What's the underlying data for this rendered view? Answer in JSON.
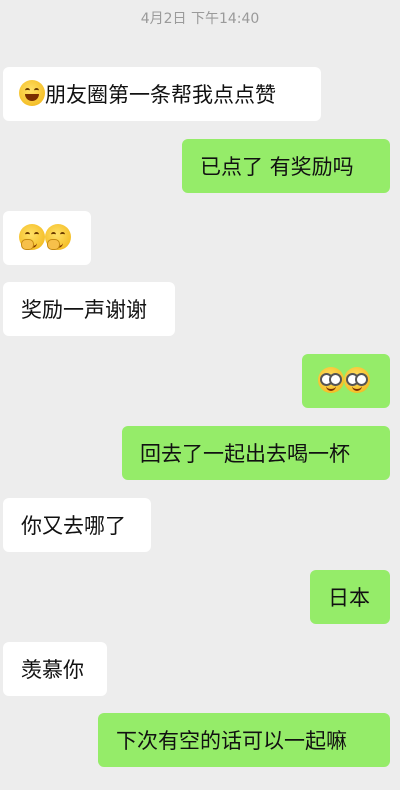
{
  "chat": {
    "timestamp": "4月2日 下午14:40",
    "messages": [
      {
        "side": "in",
        "text": "朋友圈第一条帮我点点赞",
        "emoji": "grin-emoji"
      },
      {
        "side": "out",
        "text": "已点了  有奖励吗"
      },
      {
        "side": "in",
        "text": "",
        "emoji": "thinking-emoji x2"
      },
      {
        "side": "in",
        "text": "奖励一声谢谢"
      },
      {
        "side": "out",
        "text": "",
        "emoji": "nerd-emoji x2"
      },
      {
        "side": "out",
        "text": "回去了一起出去喝一杯"
      },
      {
        "side": "in",
        "text": "你又去哪了"
      },
      {
        "side": "out",
        "text": "日本"
      },
      {
        "side": "in",
        "text": "羡慕你"
      },
      {
        "side": "out",
        "text": "下次有空的话可以一起嘛"
      }
    ]
  },
  "colors": {
    "background": "#ededed",
    "incoming_bubble": "#ffffff",
    "outgoing_bubble": "#95ec69"
  }
}
